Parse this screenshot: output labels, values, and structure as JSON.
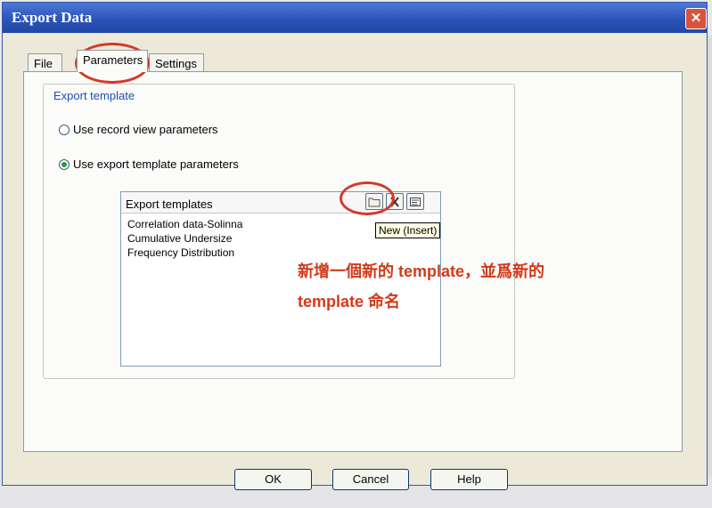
{
  "window": {
    "title": "Export Data",
    "close_symbol": "✕"
  },
  "tabs": [
    {
      "label": "File"
    },
    {
      "label": "Parameters"
    },
    {
      "label": "Settings"
    }
  ],
  "group": {
    "title": "Export template"
  },
  "options": {
    "record_view": {
      "label": "Use record view parameters",
      "checked": false
    },
    "export_template": {
      "label": "Use export template parameters",
      "checked": true
    }
  },
  "templates": {
    "header": "Export templates",
    "items": [
      "Correlation data-Solinna",
      "Cumulative Undersize",
      "Frequency Distribution"
    ],
    "new_tooltip": "New (Insert)"
  },
  "annotation": {
    "line1": "新增一個新的 template，並爲新的",
    "line2": "template 命名",
    "color": "#d23a1a"
  },
  "buttons": {
    "ok": "OK",
    "cancel": "Cancel",
    "help": "Help"
  }
}
